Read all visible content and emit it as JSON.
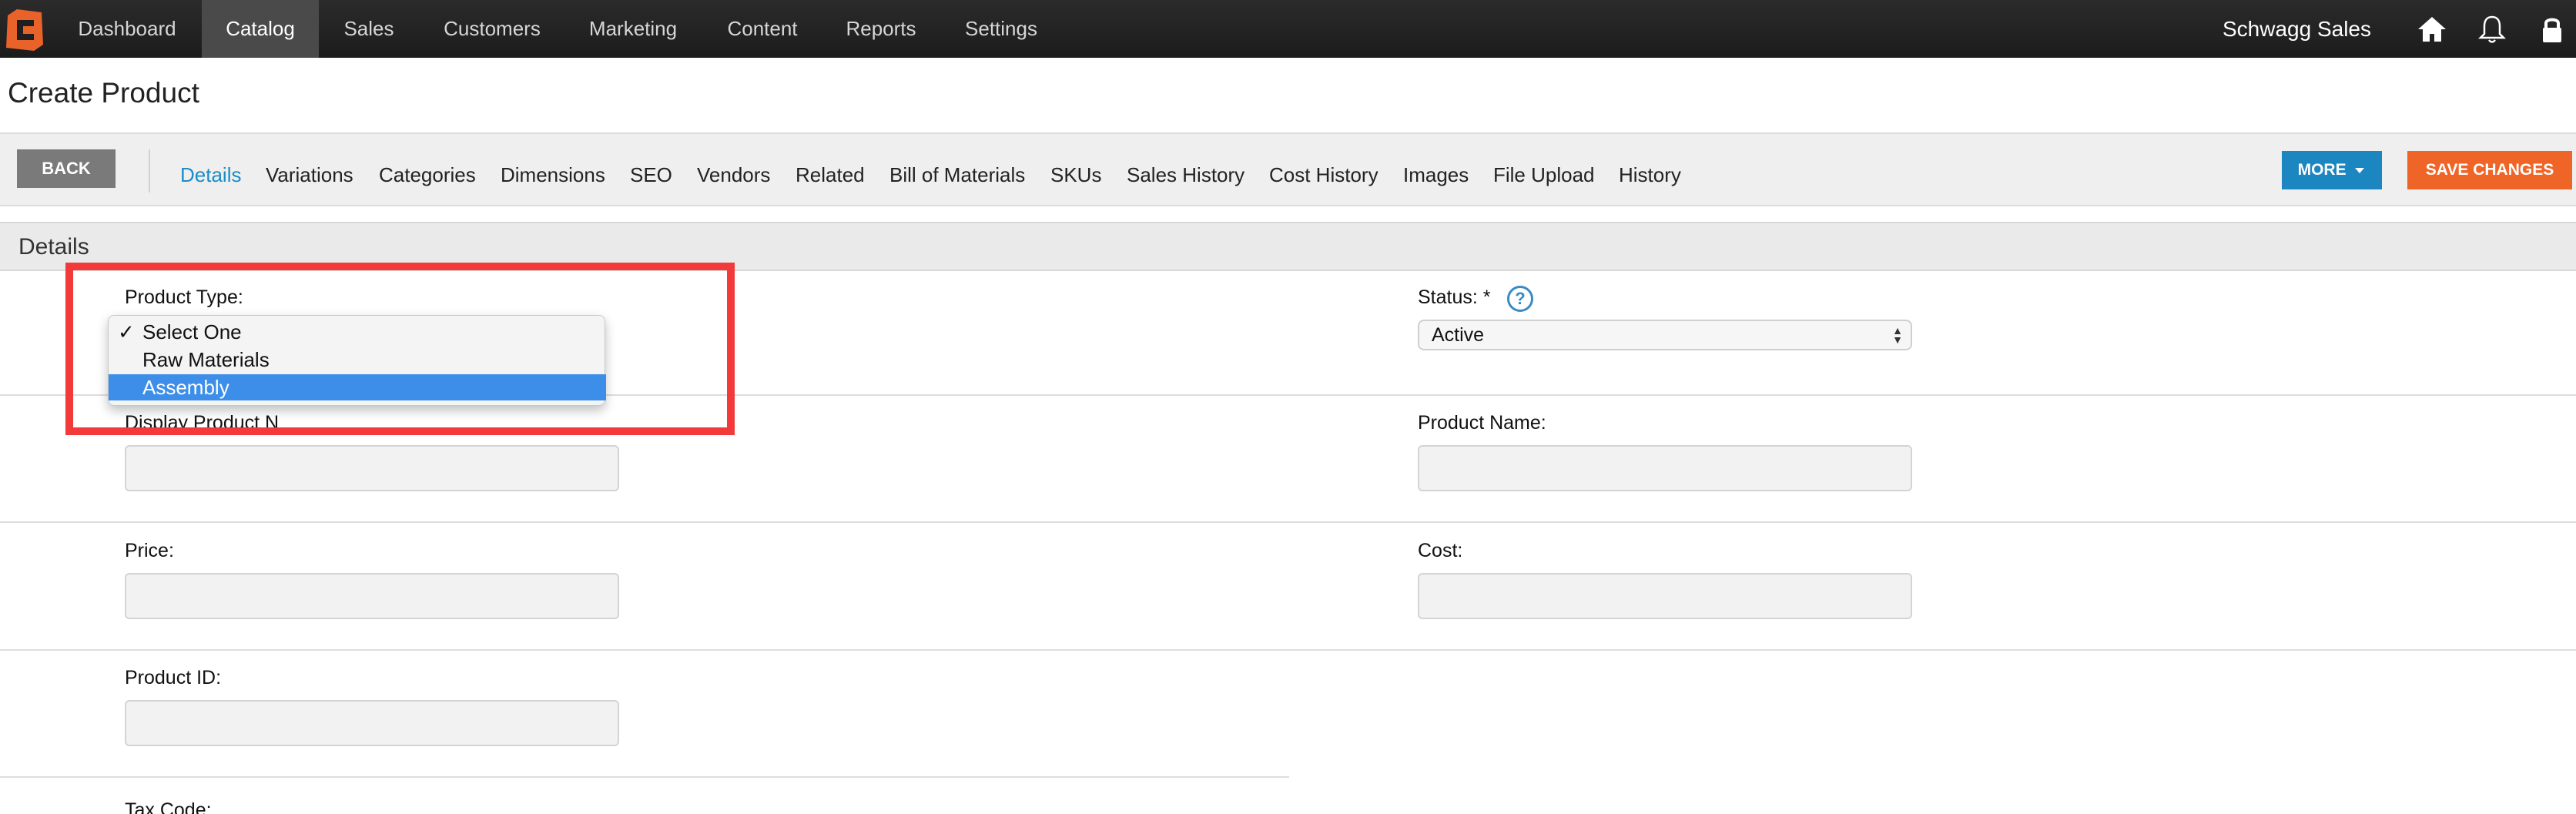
{
  "topnav": {
    "items": [
      "Dashboard",
      "Catalog",
      "Sales",
      "Customers",
      "Marketing",
      "Content",
      "Reports",
      "Settings"
    ],
    "active": "Catalog",
    "brand": "Schwagg Sales",
    "icons": [
      "home-icon",
      "bell-icon",
      "lock-icon"
    ],
    "logo_color": "#e8622a"
  },
  "page": {
    "title": "Create Product"
  },
  "toolbar": {
    "back_label": "BACK",
    "tabs": [
      "Details",
      "Variations",
      "Categories",
      "Dimensions",
      "SEO",
      "Vendors",
      "Related",
      "Bill of Materials",
      "SKUs",
      "Sales History",
      "Cost History",
      "Images",
      "File Upload",
      "History"
    ],
    "active_tab": "Details",
    "more_label": "MORE",
    "save_label": "SAVE CHANGES"
  },
  "section": {
    "title": "Details"
  },
  "form": {
    "product_type_label": "Product Type:",
    "product_type_options": [
      "Select One",
      "Raw Materials",
      "Assembly"
    ],
    "status_label": "Status: *",
    "status_value": "Active",
    "display_name_label": "Display Product N",
    "product_name_label": "Product Name:",
    "price_label": "Price:",
    "cost_label": "Cost:",
    "product_id_label": "Product ID:",
    "tax_code_label": "Tax Code:"
  },
  "dropdown": {
    "checked_index": 0,
    "highlighted_index": 2,
    "check_glyph": "✓"
  },
  "colors": {
    "accent_blue": "#1b86c0",
    "save_orange": "#ef6528",
    "highlight_red": "#f33a3a",
    "option_highlight": "#3d8ee8"
  }
}
